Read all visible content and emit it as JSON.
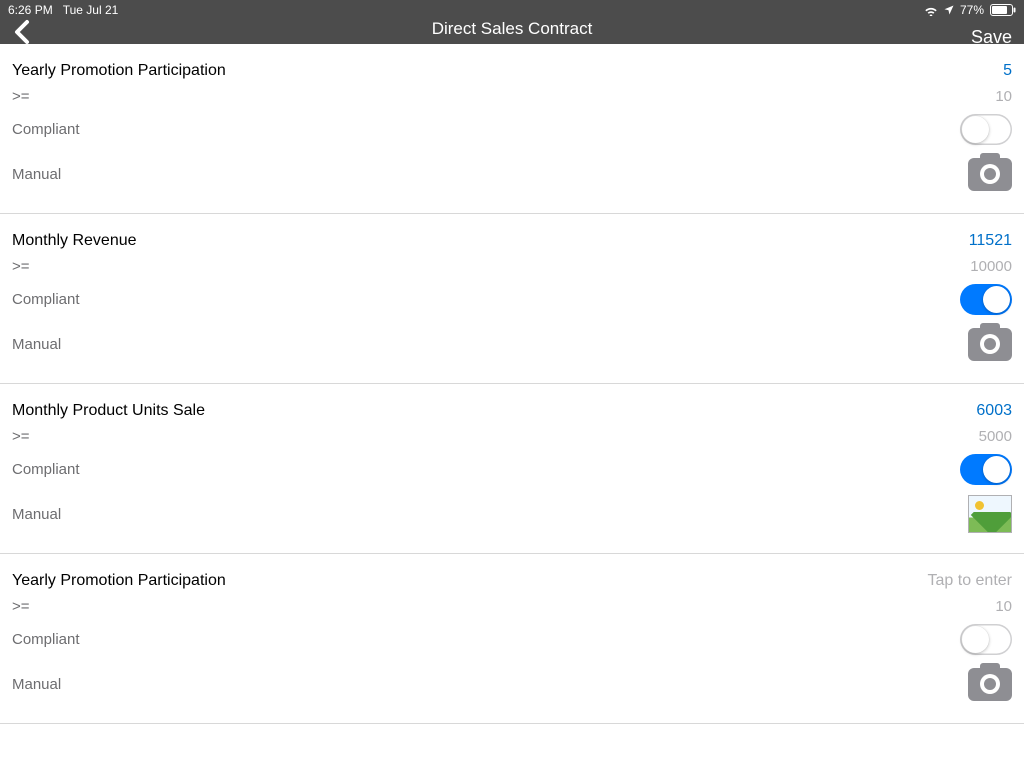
{
  "status": {
    "time": "6:26 PM",
    "date": "Tue Jul 21",
    "battery_pct": "77%"
  },
  "nav": {
    "title": "Direct Sales Contract",
    "save_label": "Save"
  },
  "labels": {
    "compliant": "Compliant",
    "manual": "Manual",
    "tap_to_enter": "Tap to enter"
  },
  "sections": [
    {
      "title": "Yearly Promotion Participation",
      "value": "5",
      "value_style": "link",
      "operator": ">=",
      "target": "10",
      "compliant": false,
      "attachment": "camera"
    },
    {
      "title": "Monthly Revenue",
      "value": "11521",
      "value_style": "link",
      "operator": ">=",
      "target": "10000",
      "compliant": true,
      "attachment": "camera"
    },
    {
      "title": "Monthly Product Units Sale",
      "value": "6003",
      "value_style": "link",
      "operator": ">=",
      "target": "5000",
      "compliant": true,
      "attachment": "image"
    },
    {
      "title": "Yearly Promotion Participation",
      "value": "Tap to enter",
      "value_style": "hint",
      "operator": ">=",
      "target": "10",
      "compliant": false,
      "attachment": "camera"
    }
  ]
}
